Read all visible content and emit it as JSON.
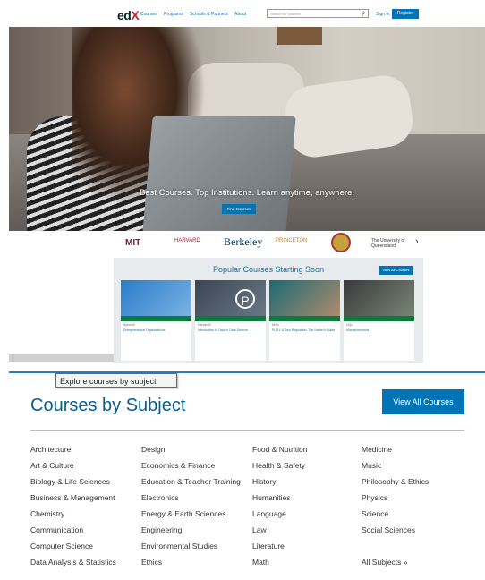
{
  "header": {
    "logo_main": "ed",
    "logo_x": "X",
    "nav": [
      "Courses",
      "Programs",
      "Schools & Partners",
      "About"
    ],
    "search_placeholder": "Search for courses",
    "sign_in": "Sign In",
    "register": "Register"
  },
  "hero": {
    "tagline": "Best Courses. Top Institutions. Learn anytime, anywhere.",
    "find_button": "Find Courses"
  },
  "partners": {
    "mit": "MIT",
    "harvard": "HARVARD",
    "berkeley": "Berkeley",
    "princeton": "PRINCETON",
    "uq": "The University of Queensland",
    "next": "›"
  },
  "popular": {
    "title": "Popular Courses Starting Soon",
    "view_all": "View All Courses",
    "cards": [
      {
        "school": "SchoolX",
        "title": "Entrepreneurial Organizations"
      },
      {
        "school": "HarvardX",
        "title": "Introduction to Data in Data Science"
      },
      {
        "school": "MITx",
        "title": "PI101: A Tour Regulation: The Nation's Guide"
      },
      {
        "school": "UQx",
        "title": "Microeconomics"
      }
    ]
  },
  "subjects": {
    "tooltip": "Explore courses by subject",
    "title": "Courses by Subject",
    "view_all": "View All Courses",
    "col1": [
      "Architecture",
      "Art & Culture",
      "Biology & Life Sciences",
      "Business & Management",
      "Chemistry",
      "Communication",
      "Computer Science",
      "Data Analysis & Statistics"
    ],
    "col2": [
      "Design",
      "Economics & Finance",
      "Education & Teacher Training",
      "Electronics",
      "Energy & Earth Sciences",
      "Engineering",
      "Environmental Studies",
      "Ethics"
    ],
    "col3": [
      "Food & Nutrition",
      "Health & Safety",
      "History",
      "Humanities",
      "Language",
      "Law",
      "Literature",
      "Math"
    ],
    "col4": [
      "Medicine",
      "Music",
      "Philosophy & Ethics",
      "Physics",
      "Science",
      "Social Sciences",
      "",
      "All Subjects »"
    ]
  },
  "colors": {
    "accent": "#0074b4",
    "heading": "#0b5d8e",
    "link": "#1b6f9b"
  }
}
